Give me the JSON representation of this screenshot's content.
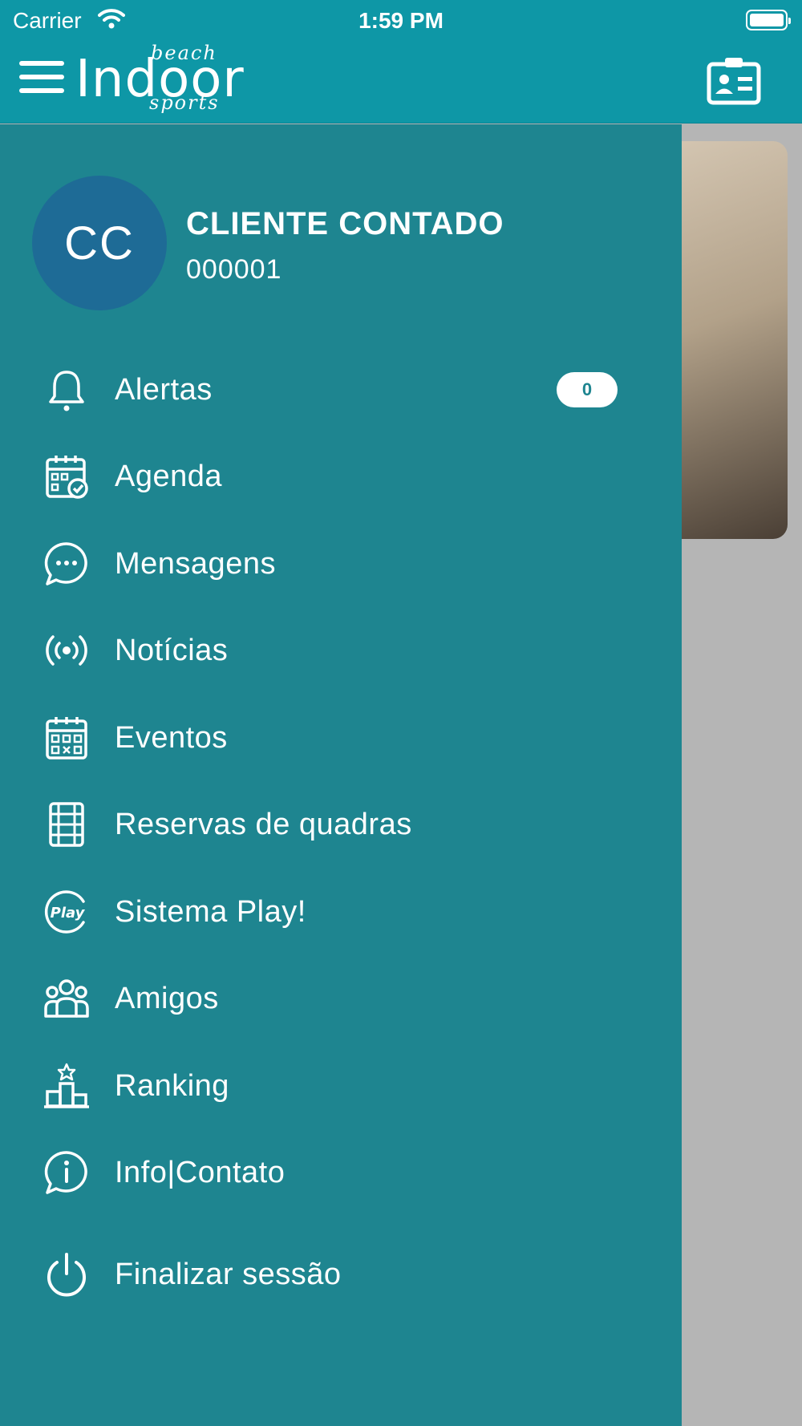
{
  "status_bar": {
    "carrier": "Carrier",
    "time": "1:59 PM"
  },
  "header": {
    "logo_main": "Indoor",
    "logo_top": "beach",
    "logo_bottom": "sports"
  },
  "user": {
    "initials": "CC",
    "name": "CLIENTE CONTADO",
    "id": "000001"
  },
  "menu": {
    "items": [
      {
        "label": "Alertas",
        "icon": "bell-icon",
        "badge": "0"
      },
      {
        "label": "Agenda",
        "icon": "calendar-check-icon"
      },
      {
        "label": "Mensagens",
        "icon": "chat-bubble-icon"
      },
      {
        "label": "Notícias",
        "icon": "broadcast-icon"
      },
      {
        "label": "Eventos",
        "icon": "calendar-grid-icon"
      },
      {
        "label": "Reservas de quadras",
        "icon": "court-icon"
      },
      {
        "label": "Sistema Play!",
        "icon": "play-logo-icon",
        "icon_text": "Play"
      },
      {
        "label": "Amigos",
        "icon": "group-icon"
      },
      {
        "label": "Ranking",
        "icon": "podium-icon"
      },
      {
        "label": "Info|Contato",
        "icon": "info-chat-icon"
      },
      {
        "label": "Finalizar sessão",
        "icon": "power-icon"
      }
    ]
  },
  "colors": {
    "header": "#0e97a6",
    "drawer": "#1e8590",
    "avatar": "#1e6b96"
  }
}
